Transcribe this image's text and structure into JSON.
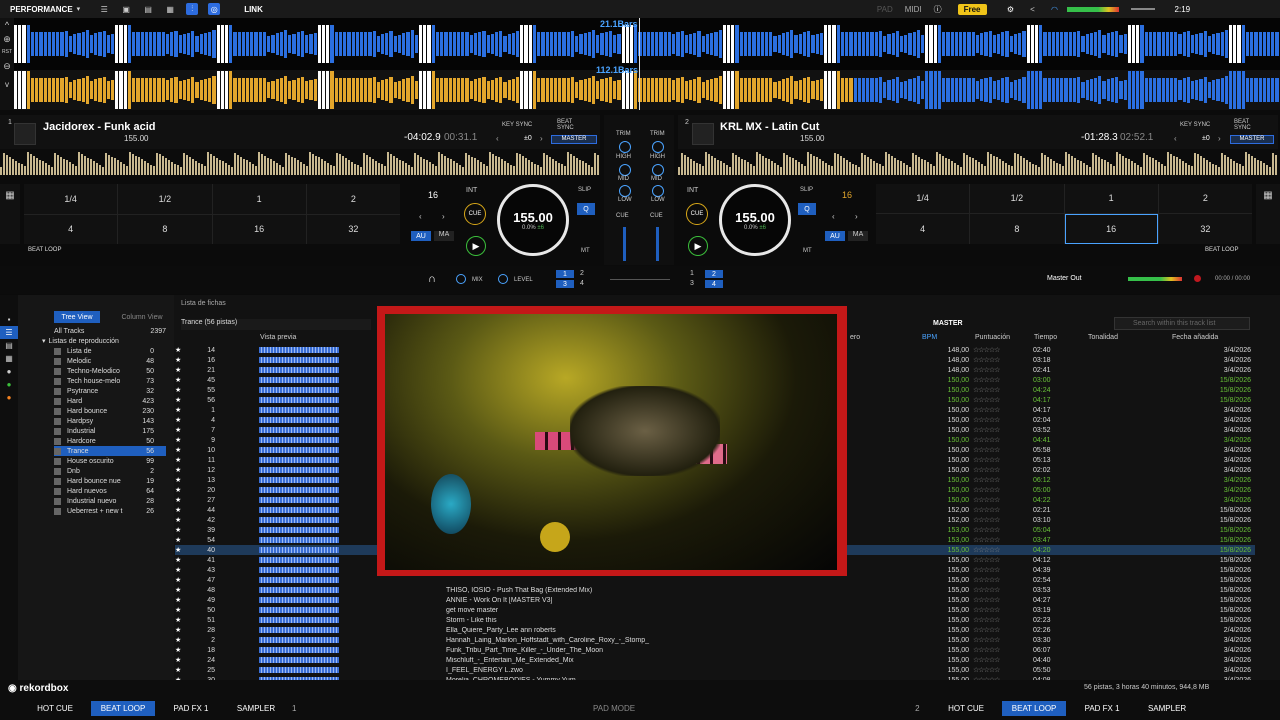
{
  "topbar": {
    "mode": "PERFORMANCE",
    "link": "LINK",
    "pad": "PAD",
    "midi": "MIDI",
    "plan": "Free",
    "time": "2:19"
  },
  "waveform": {
    "deck1_bars": "21.1Bars",
    "deck2_bars": "112.1Bars",
    "rst": "RST"
  },
  "deck1": {
    "num": "1",
    "title": "Jacidorex - Funk acid",
    "bpm": "155.00",
    "remain": "-04:02.9",
    "elapsed": "00:31.1",
    "key_sync": "KEY SYNC",
    "beat_sync": "BEAT SYNC",
    "key_val": "±0",
    "master": "MASTER",
    "loop_label": "BEAT LOOP",
    "loop_value": "16",
    "int": "INT",
    "cue": "CUE",
    "slip": "SLIP",
    "q": "Q",
    "au": "AU",
    "ma": "MA",
    "mt": "MT",
    "jog_bpm": "155.00",
    "jog_pct": "0.0%",
    "jog_pm": "±6",
    "loops": [
      "1/4",
      "1/2",
      "1",
      "2",
      "4",
      "8",
      "16",
      "32"
    ]
  },
  "deck2": {
    "num": "2",
    "title": "KRL MX - Latin Cut",
    "bpm": "155.00",
    "remain": "-01:28.3",
    "elapsed": "02:52.1",
    "key_sync": "KEY SYNC",
    "beat_sync": "BEAT SYNC",
    "key_val": "±0",
    "master": "MASTER",
    "loop_label": "BEAT LOOP",
    "loop_value": "16",
    "int": "INT",
    "cue": "CUE",
    "slip": "SLIP",
    "q": "Q",
    "au": "AU",
    "ma": "MA",
    "mt": "MT",
    "jog_bpm": "155.00",
    "jog_pct": "0.0%",
    "jog_pm": "±6",
    "loops": [
      "1/4",
      "1/2",
      "1",
      "2",
      "4",
      "8",
      "16",
      "32"
    ]
  },
  "mixer": {
    "trim": "TRIM",
    "high": "HIGH",
    "mid": "MID",
    "low": "LOW",
    "cue": "CUE",
    "mix": "MIX",
    "level": "LEVEL",
    "master_out": "Master Out",
    "times": "00:00 / 00:00",
    "b1": "1",
    "b2": "2",
    "b3": "3",
    "b4": "4"
  },
  "browser": {
    "tree_view": "Tree View",
    "column_view": "Column View",
    "list_title": "Lista de fichas",
    "playlist_header": "Trance (56 pistas)",
    "master": "MASTER",
    "search_placeholder": "Search within this track list",
    "status": "56 pistas, 3 horas 40 minutos, 944,8 MB",
    "columns": {
      "preview": "Vista previa",
      "genre": "ero",
      "bpm": "BPM",
      "rating": "Puntuación",
      "time": "Tiempo",
      "key": "Tonalidad",
      "added": "Fecha añadida"
    }
  },
  "tree": {
    "all_tracks": "All Tracks",
    "all_count": "2397",
    "playlists": "Listas de reproducción",
    "items": [
      {
        "n": "Lista de",
        "c": "0"
      },
      {
        "n": "Melodic",
        "c": "48"
      },
      {
        "n": "Techno-Melodico",
        "c": "50"
      },
      {
        "n": "Tech house-melo",
        "c": "73"
      },
      {
        "n": "Psytrance",
        "c": "32"
      },
      {
        "n": "Hard",
        "c": "423"
      },
      {
        "n": "Hard bounce",
        "c": "230"
      },
      {
        "n": "Hardpsy",
        "c": "143"
      },
      {
        "n": "Industrial",
        "c": "175"
      },
      {
        "n": "Hardcore",
        "c": "50"
      },
      {
        "n": "Trance",
        "c": "56"
      },
      {
        "n": "House oscurito",
        "c": "99"
      },
      {
        "n": "Dnb",
        "c": "2"
      },
      {
        "n": "Hard bounce nue",
        "c": "19"
      },
      {
        "n": "Hard nuevos",
        "c": "64"
      },
      {
        "n": "Industrial nuevo",
        "c": "28"
      },
      {
        "n": "Ueberrest + new t",
        "c": "26"
      }
    ]
  },
  "tracks": [
    {
      "n": "14",
      "t": "",
      "b": "148,00",
      "tm": "02:40",
      "d": "3/4/2026",
      "g": false
    },
    {
      "n": "16",
      "t": "",
      "b": "148,00",
      "tm": "03:18",
      "d": "3/4/2026",
      "g": false
    },
    {
      "n": "21",
      "t": "",
      "b": "148,00",
      "tm": "02:41",
      "d": "3/4/2026",
      "g": false
    },
    {
      "n": "45",
      "t": "",
      "b": "150,00",
      "tm": "03:00",
      "d": "15/8/2026",
      "g": true
    },
    {
      "n": "55",
      "t": "",
      "b": "150,00",
      "tm": "04:24",
      "d": "15/8/2026",
      "g": true
    },
    {
      "n": "56",
      "t": "",
      "b": "150,00",
      "tm": "04:17",
      "d": "15/8/2026",
      "g": true
    },
    {
      "n": "1",
      "t": "",
      "b": "150,00",
      "tm": "04:17",
      "d": "3/4/2026",
      "g": false
    },
    {
      "n": "4",
      "t": "",
      "b": "150,00",
      "tm": "02:04",
      "d": "3/4/2026",
      "g": false
    },
    {
      "n": "7",
      "t": "",
      "b": "150,00",
      "tm": "03:52",
      "d": "3/4/2026",
      "g": false
    },
    {
      "n": "9",
      "t": "",
      "b": "150,00",
      "tm": "04:41",
      "d": "3/4/2026",
      "g": true
    },
    {
      "n": "10",
      "t": "",
      "b": "150,00",
      "tm": "05:58",
      "d": "3/4/2026",
      "g": false
    },
    {
      "n": "11",
      "t": "",
      "b": "150,00",
      "tm": "05:13",
      "d": "3/4/2026",
      "g": false
    },
    {
      "n": "12",
      "t": "",
      "b": "150,00",
      "tm": "02:02",
      "d": "3/4/2026",
      "g": false
    },
    {
      "n": "13",
      "t": "",
      "b": "150,00",
      "tm": "06:12",
      "d": "3/4/2026",
      "g": true
    },
    {
      "n": "20",
      "t": "",
      "b": "150,00",
      "tm": "05:00",
      "d": "3/4/2026",
      "g": true
    },
    {
      "n": "27",
      "t": "",
      "b": "150,00",
      "tm": "04:22",
      "d": "3/4/2026",
      "g": true
    },
    {
      "n": "44",
      "t": "",
      "b": "152,00",
      "tm": "02:21",
      "d": "15/8/2026",
      "g": false
    },
    {
      "n": "42",
      "t": "",
      "b": "152,00",
      "tm": "03:10",
      "d": "15/8/2026",
      "g": false
    },
    {
      "n": "39",
      "t": "",
      "b": "153,00",
      "tm": "05:04",
      "d": "15/8/2026",
      "g": true
    },
    {
      "n": "54",
      "t": "",
      "b": "153,00",
      "tm": "03:47",
      "d": "15/8/2026",
      "g": true
    },
    {
      "n": "40",
      "t": "",
      "b": "155,00",
      "tm": "04:20",
      "d": "15/8/2026",
      "g": true,
      "sel": true
    },
    {
      "n": "41",
      "t": "",
      "b": "155,00",
      "tm": "04:12",
      "d": "15/8/2026",
      "g": false
    },
    {
      "n": "43",
      "t": "",
      "b": "155,00",
      "tm": "04:39",
      "d": "15/8/2026",
      "g": false
    },
    {
      "n": "47",
      "t": "",
      "b": "155,00",
      "tm": "02:54",
      "d": "15/8/2026",
      "g": false
    },
    {
      "n": "48",
      "t": "THISO, IOSIO - Push That Bag (Extended Mix)",
      "b": "155,00",
      "tm": "03:53",
      "d": "15/8/2026",
      "g": false
    },
    {
      "n": "49",
      "t": "ANNIE - Work On It [MASTER V3]",
      "b": "155,00",
      "tm": "04:27",
      "d": "15/8/2026",
      "g": false
    },
    {
      "n": "50",
      "t": "get move master",
      "b": "155,00",
      "tm": "03:19",
      "d": "15/8/2026",
      "g": false
    },
    {
      "n": "51",
      "t": "Storm - Like this",
      "b": "155,00",
      "tm": "02:23",
      "d": "15/8/2026",
      "g": false
    },
    {
      "n": "28",
      "t": "Ella_Quiere_Party_Lee ann roberts",
      "b": "155,00",
      "tm": "02:26",
      "d": "2/4/2026",
      "g": false
    },
    {
      "n": "2",
      "t": "Hannah_Laing_Marlon_Hoffstadt_with_Caroline_Roxy_-_Stomp_",
      "b": "155,00",
      "tm": "03:30",
      "d": "3/4/2026",
      "g": false
    },
    {
      "n": "18",
      "t": "Funk_Tribu_Part_Time_Killer_-_Under_The_Moon",
      "b": "155,00",
      "tm": "06:07",
      "d": "3/4/2026",
      "g": false
    },
    {
      "n": "24",
      "t": "Mischluft_-_Entertain_Me_Extended_Mix",
      "b": "155,00",
      "tm": "04:40",
      "d": "3/4/2026",
      "g": false
    },
    {
      "n": "25",
      "t": "I_FEEL_ENERGY L.zwo",
      "b": "155,00",
      "tm": "05:50",
      "d": "3/4/2026",
      "g": false
    },
    {
      "n": "30",
      "t": "Morelia_CHROMEBODIES - Yummy Yum",
      "b": "155,00",
      "tm": "04:08",
      "d": "3/4/2026",
      "g": false
    }
  ],
  "bottom": {
    "hot_cue": "HOT CUE",
    "beat_loop": "BEAT LOOP",
    "pad_fx": "PAD FX 1",
    "sampler": "SAMPLER",
    "deck1": "1",
    "deck2": "2",
    "pad_mode": "PAD MODE",
    "logo": "rekordbox"
  },
  "colors": {
    "accent": "#1f5fbf",
    "wave_blue": "#2b6fe0",
    "wave_orange": "#e3a62c",
    "green": "#69c238"
  }
}
